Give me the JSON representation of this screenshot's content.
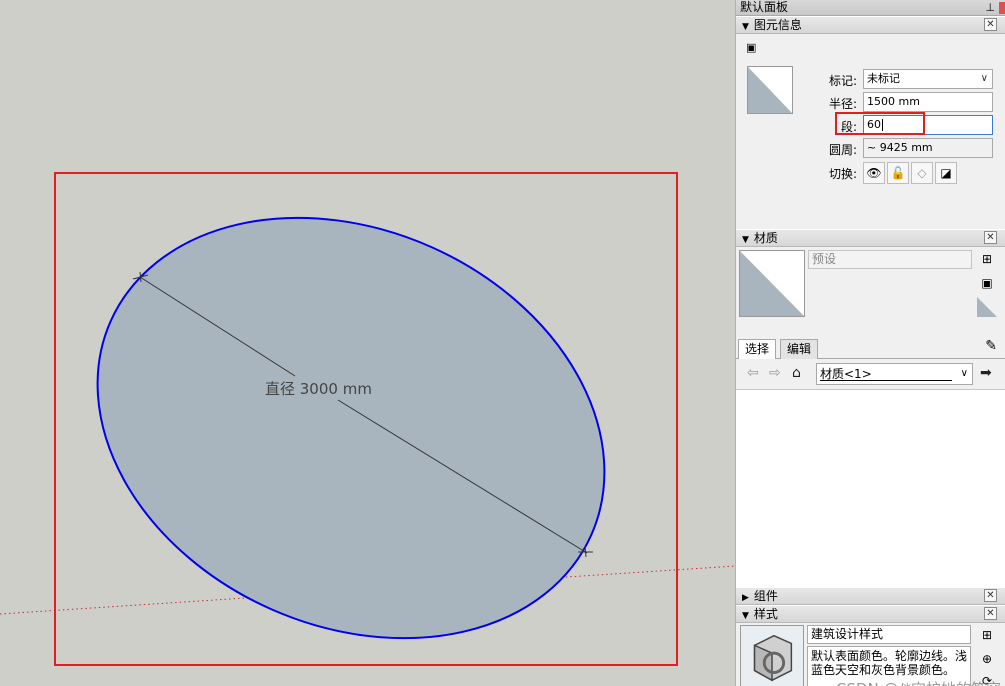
{
  "tray": {
    "title": "默认面板",
    "pin": "⊥"
  },
  "entity_info": {
    "header": "图元信息",
    "type_icon": "circle-icon",
    "fields": {
      "tag_label": "标记:",
      "tag_value": "未标记",
      "radius_label": "半径:",
      "radius_value": "1500 mm",
      "segments_label": "段:",
      "segments_value": "60",
      "circumference_label": "圆周:",
      "circumference_value": "~ 9425 mm",
      "toggle_label": "切换:"
    },
    "toggles": [
      "eye-icon",
      "lock-icon",
      "receive-shadow-icon",
      "cast-shadow-icon"
    ]
  },
  "materials": {
    "header": "材质",
    "name_placeholder": "预设",
    "tabs": [
      "选择",
      "编辑"
    ],
    "active_tab": "选择",
    "library_value": "材质<1>"
  },
  "components": {
    "header": "组件"
  },
  "styles": {
    "header": "样式",
    "style_name": "建筑设计样式",
    "description": "默认表面颜色。轮廓边线。浅蓝色天空和灰色背景颜色。"
  },
  "viewport": {
    "dimension_label": "直径 3000 mm",
    "selection_box_color": "#e02020",
    "circle_edge_color": "#0000ee",
    "face_color": "#a8b5bf",
    "axis_color": "#c03030"
  },
  "watermark": "CSDN @/*守护她的笑容"
}
